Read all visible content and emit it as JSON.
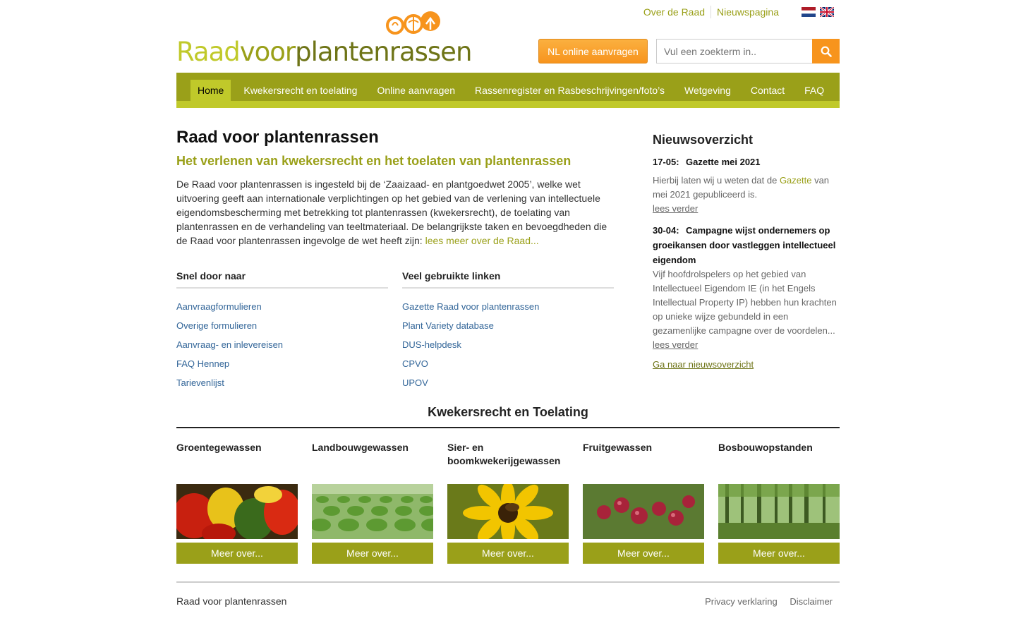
{
  "header": {
    "logo": {
      "part1": "Raad",
      "part2": "voor",
      "part3": "plantenrassen"
    },
    "top_links": [
      "Over de Raad",
      "Nieuwspagina"
    ],
    "online_button": "NL online aanvragen",
    "search_placeholder": "Vul een zoekterm in.."
  },
  "nav": {
    "items": [
      {
        "label": "Home",
        "active": true
      },
      {
        "label": "Kwekersrecht en toelating"
      },
      {
        "label": "Online aanvragen"
      },
      {
        "label": "Rassenregister en Rasbeschrijvingen/foto’s"
      },
      {
        "label": "Wetgeving"
      },
      {
        "label": "Contact"
      },
      {
        "label": "FAQ"
      }
    ]
  },
  "main": {
    "title": "Raad voor plantenrassen",
    "subtitle": "Het verlenen van kwekersrecht en het toelaten van plantenrassen",
    "intro": "De Raad voor plantenrassen is ingesteld bij de ‘Zaaizaad- en plantgoedwet 2005’, welke wet uitvoering geeft aan internationale verplichtingen op het gebied van de verlening van intellectuele eigendomsbescherming met betrekking tot plantenrassen (kwekersrecht), de toelating van plantenrassen en de verhandeling van teeltmateriaal. De belangrijkste taken en bevoegdheden die de Raad voor plantenrassen ingevolge de wet heeft zijn: ",
    "intro_link": "lees meer over de Raad..."
  },
  "quick": {
    "title": "Snel door naar",
    "links": [
      "Aanvraagformulieren",
      "Overige formulieren",
      "Aanvraag- en inlevereisen",
      "FAQ Hennep",
      "Tarievenlijst"
    ]
  },
  "used": {
    "title": "Veel gebruikte linken",
    "links": [
      "Gazette Raad voor plantenrassen",
      "Plant Variety database",
      "DUS-helpdesk",
      "CPVO",
      "UPOV"
    ]
  },
  "news": {
    "title": "Nieuwsoverzicht",
    "items": [
      {
        "date": "17-05:",
        "title": "Gazette mei 2021",
        "text_before": "Hierbij laten wij u weten dat de ",
        "text_link": "Gazette",
        "text_after": " van mei 2021 gepubliceerd is.",
        "more": "lees verder"
      },
      {
        "date": "30-04:",
        "title": "Campagne wijst ondernemers op groeikansen door vastleggen intellectueel eigendom",
        "text": "Vijf hoofdrolspelers op het gebied van Intellectueel Eigendom IE (in het Engels Intellectual Property IP) hebben hun krachten op unieke wijze gebundeld in een gezamenlijke campagne over de voordelen...",
        "more": "lees verder"
      }
    ],
    "all": "Ga naar nieuwsoverzicht"
  },
  "categories": {
    "title": "Kwekersrecht en Toelating",
    "button": "Meer over...",
    "items": [
      "Groentegewassen",
      "Landbouwgewassen",
      "Sier- en boomkwekerijgewassen",
      "Fruitgewassen",
      "Bosbouwopstanden"
    ]
  },
  "footer": {
    "name": "Raad voor plantenrassen",
    "links": [
      "Privacy verklaring",
      "Disclaimer"
    ]
  },
  "colors": {
    "primary_green": "#9aa019",
    "light_green": "#c0c92a",
    "orange": "#f7941d",
    "link_blue": "#336699"
  }
}
